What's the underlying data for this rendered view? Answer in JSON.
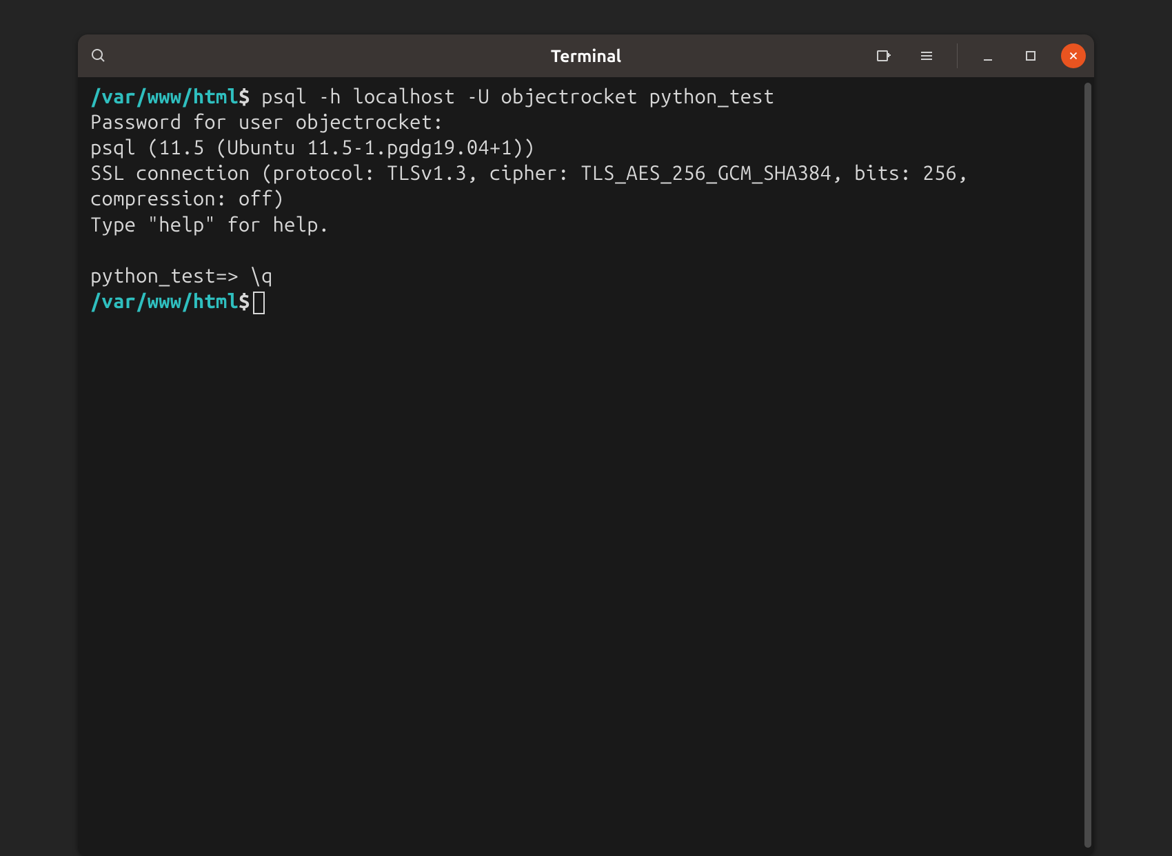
{
  "titlebar": {
    "title": "Terminal"
  },
  "terminal": {
    "lines": [
      {
        "type": "prompt-line",
        "path": "/var/www/html",
        "dollar": "$",
        "cmd": " psql -h localhost -U objectrocket python_test"
      },
      {
        "type": "output",
        "text": "Password for user objectrocket:"
      },
      {
        "type": "output",
        "text": "psql (11.5 (Ubuntu 11.5-1.pgdg19.04+1))"
      },
      {
        "type": "output",
        "text": "SSL connection (protocol: TLSv1.3, cipher: TLS_AES_256_GCM_SHA384, bits: 256, compression: off)"
      },
      {
        "type": "output",
        "text": "Type \"help\" for help."
      },
      {
        "type": "output",
        "text": ""
      },
      {
        "type": "output",
        "text": "python_test=> \\q"
      },
      {
        "type": "prompt-cursor",
        "path": "/var/www/html",
        "dollar": "$"
      }
    ]
  }
}
